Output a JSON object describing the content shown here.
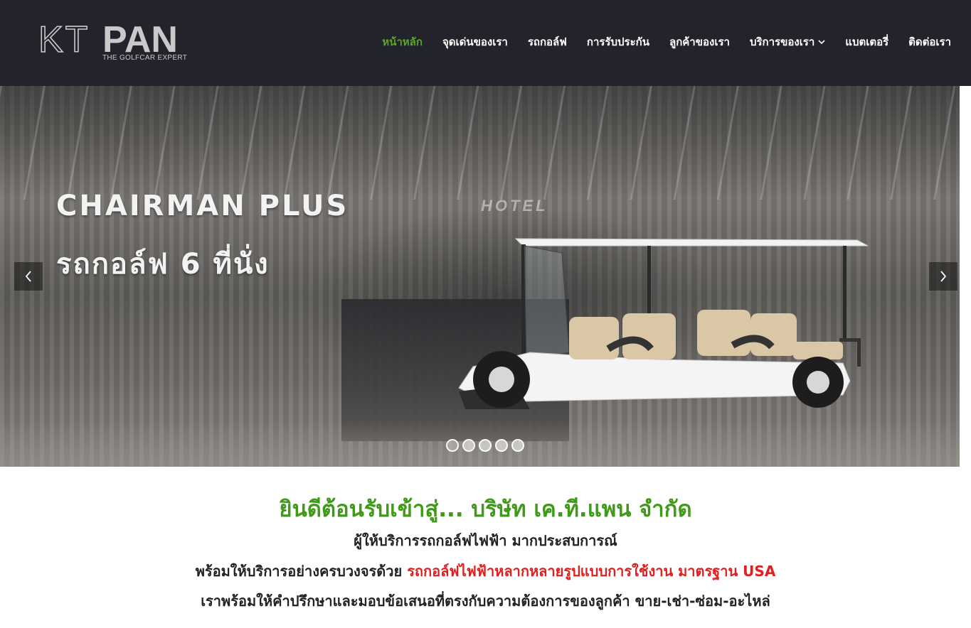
{
  "header": {
    "logo": {
      "kt": "KT",
      "pan": "PAN",
      "tagline": "THE GOLFCAR EXPERT"
    },
    "nav": [
      {
        "label": "หน้าหลัก",
        "active": true
      },
      {
        "label": "จุดเด่นของเรา"
      },
      {
        "label": "รถกอล์ฟ"
      },
      {
        "label": "การรับประกัน"
      },
      {
        "label": "ลูกค้าของเรา"
      },
      {
        "label": "บริการของเรา",
        "dropdown": true
      },
      {
        "label": "แบตเตอรี่"
      },
      {
        "label": "ติดต่อเรา"
      }
    ],
    "dropdown_icon": "chevron-down-icon"
  },
  "hero": {
    "headline": "CHAIRMAN PLUS",
    "subline": "รถกอล์ฟ 6 ที่นั่ง",
    "sign_text": "HOTEL",
    "prev_icon": "chevron-left-icon",
    "next_icon": "chevron-right-icon",
    "slide_count": 5,
    "active_slide": 1
  },
  "welcome": {
    "title": "ยินดีต้อนรับเข้าสู่... บริษัท เค.ที.แพน จำกัด",
    "line1": "ผู้ให้บริการรถกอล์ฟไฟฟ้า มากประสบการณ์",
    "line2_prefix": "พร้อมให้บริการอย่างครบวงจรด้วย ",
    "line2_highlight": "รถกอล์ฟไฟฟ้าหลากหลายรูปแบบการใช้งาน มาตรฐาน USA",
    "line3": "เราพร้อมให้คำปรึกษาและมอบข้อเสนอที่ตรงกับความต้องการของลูกค้า ขาย-เช่า-ซ่อม-อะไหล่"
  },
  "colors": {
    "header_bg": "#23242b",
    "accent_green": "#3f9a18",
    "nav_active": "#5aa52b",
    "highlight_red": "#e02020"
  }
}
